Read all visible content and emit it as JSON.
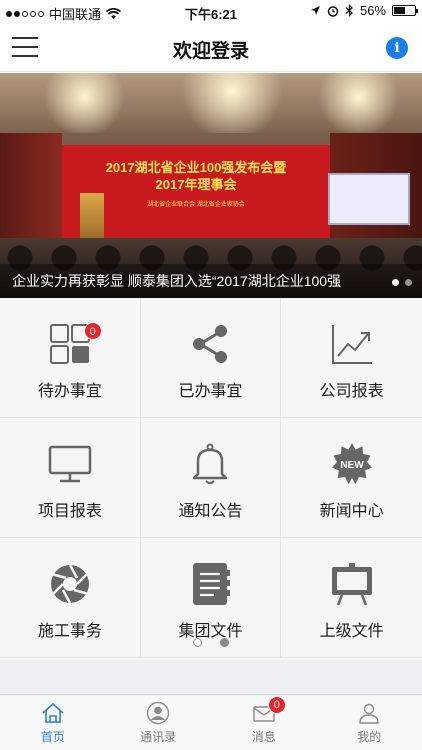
{
  "status_bar": {
    "carrier": "中国联通",
    "time": "下午6:21",
    "battery": "56%",
    "battery_level": 0.56
  },
  "nav": {
    "title": "欢迎登录",
    "menu_icon": "menu-icon",
    "info_label": "i"
  },
  "banner": {
    "backdrop_line1": "2017湖北省企业100强发布会暨",
    "backdrop_line2": "2017年理事会",
    "backdrop_line3": "湖北省企业联合会 湖北省企业家协会",
    "caption": "企业实力再获彰显 顺泰集团入选“2017湖北企业100强",
    "slide_count": 2,
    "active_slide": 1
  },
  "grid": {
    "items": [
      {
        "label": "待办事宜",
        "icon": "grid-icon",
        "badge": "0"
      },
      {
        "label": "已办事宜",
        "icon": "share-icon"
      },
      {
        "label": "公司报表",
        "icon": "trend-chart-icon"
      },
      {
        "label": "项目报表",
        "icon": "monitor-icon"
      },
      {
        "label": "通知公告",
        "icon": "bell-icon"
      },
      {
        "label": "新闻中心",
        "icon": "new-badge-icon",
        "icon_text": "NEW"
      },
      {
        "label": "施工事务",
        "icon": "aperture-icon"
      },
      {
        "label": "集团文件",
        "icon": "notebook-icon"
      },
      {
        "label": "上级文件",
        "icon": "easel-board-icon"
      }
    ],
    "page_count": 2,
    "active_page": 1
  },
  "tabbar": {
    "tabs": [
      {
        "label": "首页",
        "icon": "home-icon",
        "active": true
      },
      {
        "label": "通讯录",
        "icon": "contacts-icon",
        "active": false
      },
      {
        "label": "消息",
        "icon": "mail-icon",
        "active": false,
        "badge": "0"
      },
      {
        "label": "我的",
        "icon": "user-icon",
        "active": false
      }
    ]
  },
  "colors": {
    "accent": "#2d7fd8",
    "badge": "#e8262a",
    "icon_gray": "#666666"
  }
}
